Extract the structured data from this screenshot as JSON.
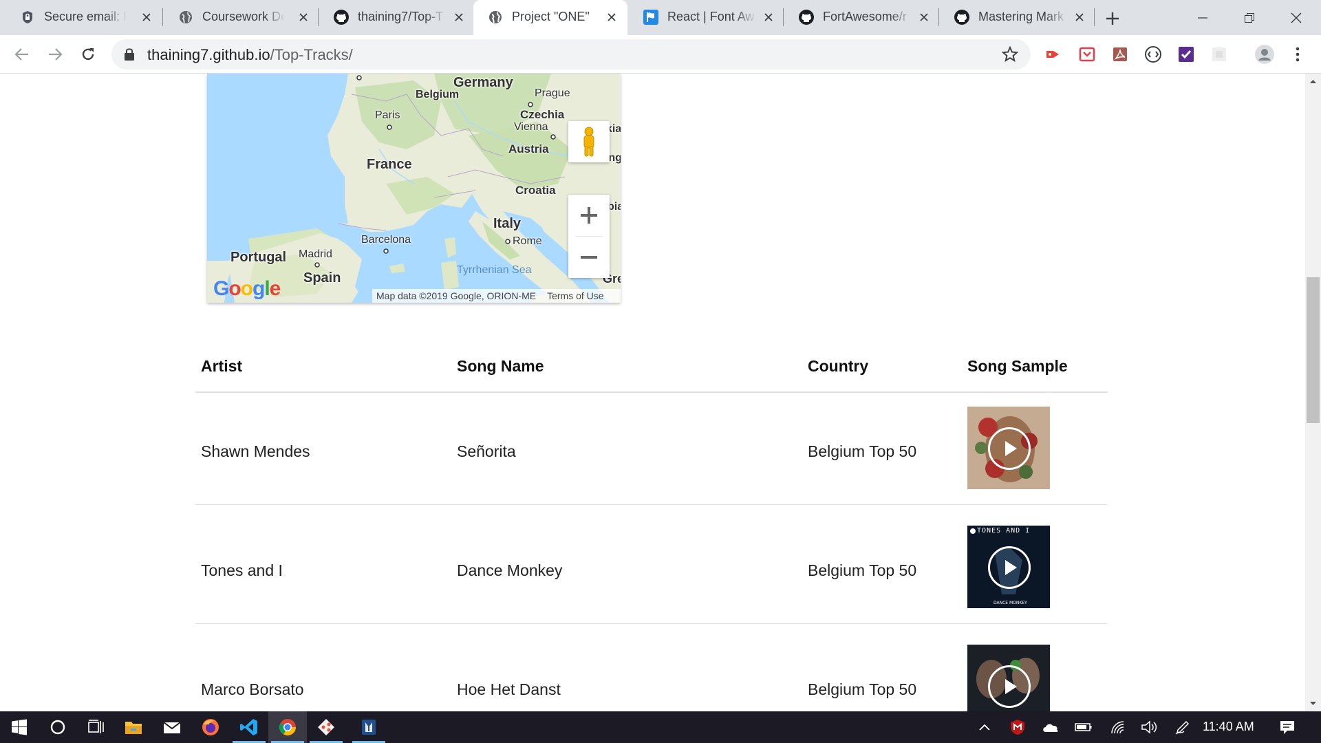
{
  "browser": {
    "tabs": [
      {
        "title": "Secure email: Pr",
        "favicon": "protonmail-icon"
      },
      {
        "title": "Coursework Det",
        "favicon": "globe-icon"
      },
      {
        "title": "thaining7/Top-T",
        "favicon": "github-icon"
      },
      {
        "title": "Project \"ONE\"",
        "favicon": "globe-icon",
        "active": true
      },
      {
        "title": "React | Font Aw",
        "favicon": "font-awesome-flag-icon"
      },
      {
        "title": "FortAwesome/r",
        "favicon": "github-icon"
      },
      {
        "title": "Mastering Mark",
        "favicon": "github-icon"
      }
    ],
    "url_host": "thaining7.github.io",
    "url_path": "/Top-Tracks/"
  },
  "map": {
    "labels": {
      "belgium": "Belgium",
      "germany": "Germany",
      "prague": "Prague",
      "paris": "Paris",
      "czechia": "Czechia",
      "vienna": "Vienna",
      "austria": "Austria",
      "france": "France",
      "croatia": "Croatia",
      "italy": "Italy",
      "barcelona": "Barcelona",
      "rome": "Rome",
      "portugal": "Portugal",
      "madrid": "Madrid",
      "spain": "Spain",
      "tyrrhenian": "Tyrrhenian Sea",
      "hungary": "Hungary",
      "kia": "kia",
      "bia": "bia",
      "gre": "Gre"
    },
    "attribution": "Map data ©2019 Google, ORION-ME",
    "terms": "Terms of Use",
    "logo": "Google",
    "colors": {
      "water": "#aadaff",
      "land": "#e9ecd9",
      "green": "#c9dfb0"
    }
  },
  "table": {
    "headers": {
      "artist": "Artist",
      "song": "Song Name",
      "country": "Country",
      "sample": "Song Sample"
    },
    "rows": [
      {
        "artist": "Shawn Mendes",
        "song": "Señorita",
        "country": "Belgium Top 50",
        "cover": "shawn-mendes-cover"
      },
      {
        "artist": "Tones and I",
        "song": "Dance Monkey",
        "country": "Belgium Top 50",
        "cover": "tones-and-i-cover",
        "cover_text": "TONES AND I",
        "cover_subtext": "DANCE MONKEY"
      },
      {
        "artist": "Marco Borsato",
        "song": "Hoe Het Danst",
        "country": "Belgium Top 50",
        "cover": "marco-borsato-cover"
      }
    ]
  },
  "taskbar": {
    "clock": "11:40 AM",
    "apps": [
      "start",
      "cortana",
      "task-view",
      "file-explorer",
      "mail",
      "firefox",
      "vscode",
      "chrome",
      "git",
      "app"
    ]
  }
}
